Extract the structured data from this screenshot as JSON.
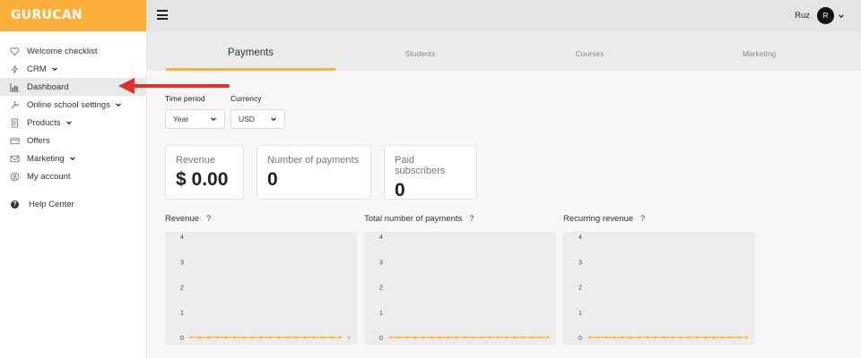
{
  "brand": {
    "name": "GURUCAN"
  },
  "sidebar": {
    "items": [
      {
        "label": "Welcome checklist",
        "icon": "heart-icon",
        "has_children": false,
        "active": false
      },
      {
        "label": "CRM",
        "icon": "bolt-icon",
        "has_children": true,
        "active": false
      },
      {
        "label": "Dashboard",
        "icon": "bar-chart-icon",
        "has_children": false,
        "active": true
      },
      {
        "label": "Online school settings",
        "icon": "wrench-icon",
        "has_children": true,
        "active": false
      },
      {
        "label": "Products",
        "icon": "document-icon",
        "has_children": true,
        "active": false
      },
      {
        "label": "Offers",
        "icon": "card-icon",
        "has_children": false,
        "active": false
      },
      {
        "label": "Marketing",
        "icon": "envelope-icon",
        "has_children": true,
        "active": false
      },
      {
        "label": "My account",
        "icon": "user-circle-icon",
        "has_children": false,
        "active": false
      }
    ],
    "help": {
      "label": "Help Center",
      "icon": "question-circle-icon"
    }
  },
  "header": {
    "user_name": "Ruz",
    "avatar_initial": "R"
  },
  "tabs": [
    {
      "label": "Payments",
      "active": true
    },
    {
      "label": "Students",
      "active": false
    },
    {
      "label": "Courses",
      "active": false
    },
    {
      "label": "Marketing",
      "active": false
    }
  ],
  "filters": {
    "time_period": {
      "label": "Time period",
      "value": "Year"
    },
    "currency": {
      "label": "Currency",
      "value": "USD"
    }
  },
  "cards": [
    {
      "title": "Revenue",
      "value": "$ 0.00"
    },
    {
      "title": "Number of payments",
      "value": "0"
    },
    {
      "title": "Paid subscribers",
      "value": "0"
    }
  ],
  "colors": {
    "accent": "#fbb03b",
    "annotation": "#e0322b"
  },
  "chart_data": [
    {
      "type": "line",
      "title": "Revenue",
      "help_icon": "?",
      "yticks": [
        "4",
        "3",
        "2",
        "1",
        "0"
      ],
      "ylim": [
        0,
        4
      ],
      "values": [
        0,
        0,
        0,
        0,
        0,
        0,
        0,
        0,
        0,
        0,
        0,
        0,
        0,
        0,
        0,
        0,
        0,
        0,
        0
      ],
      "gap_before_last": true
    },
    {
      "type": "line",
      "title": "Total number of payments",
      "help_icon": "?",
      "yticks": [
        "4",
        "3",
        "2",
        "1",
        "0"
      ],
      "ylim": [
        0,
        4
      ],
      "values": [
        0,
        0,
        0,
        0,
        0,
        0,
        0,
        0,
        0,
        0,
        0,
        0,
        0,
        0,
        0,
        0,
        0,
        0,
        0,
        0
      ],
      "gap_before_last": false
    },
    {
      "type": "line",
      "title": "Recurring revenue",
      "help_icon": "?",
      "yticks": [
        "4",
        "3",
        "2",
        "1",
        "0"
      ],
      "ylim": [
        0,
        4
      ],
      "values": [
        0,
        0,
        0,
        0,
        0,
        0,
        0,
        0,
        0,
        0,
        0,
        0,
        0,
        0,
        0,
        0,
        0,
        0,
        0,
        0
      ],
      "gap_before_last": false
    }
  ]
}
